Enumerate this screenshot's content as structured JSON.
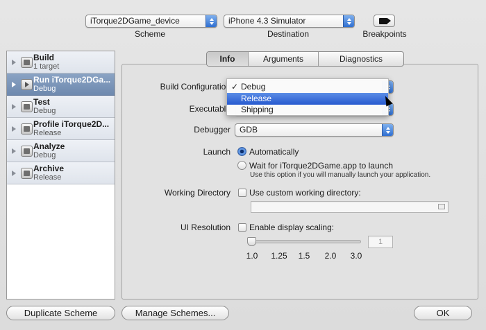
{
  "header": {
    "scheme_value": "iTorque2DGame_device",
    "scheme_caption": "Scheme",
    "destination_value": "iPhone 4.3 Simulator",
    "destination_caption": "Destination",
    "breakpoints_caption": "Breakpoints"
  },
  "actions": [
    {
      "name": "Build",
      "sub": "1 target"
    },
    {
      "name": "Run iTorque2DGa...",
      "sub": "Debug"
    },
    {
      "name": "Test",
      "sub": "Debug"
    },
    {
      "name": "Profile iTorque2D...",
      "sub": "Release"
    },
    {
      "name": "Analyze",
      "sub": "Debug"
    },
    {
      "name": "Archive",
      "sub": "Release"
    }
  ],
  "tabs": [
    "Info",
    "Arguments",
    "Diagnostics"
  ],
  "form": {
    "build_config_label": "Build Configuration",
    "executable_label": "Executable",
    "debugger_label": "Debugger",
    "debugger_value": "GDB",
    "launch_label": "Launch",
    "launch_auto": "Automatically",
    "launch_wait": "Wait for iTorque2DGame.app to launch",
    "launch_hint": "Use this option if you will manually launch your application.",
    "working_dir_label": "Working Directory",
    "working_dir_option": "Use custom working directory:",
    "ui_res_label": "UI Resolution",
    "ui_res_option": "Enable display scaling:",
    "scale_value": "1",
    "scale_ticks": [
      "1.0",
      "1.25",
      "1.5",
      "2.0",
      "3.0"
    ]
  },
  "menu": {
    "items": [
      "Debug",
      "Release",
      "Shipping"
    ],
    "checked": "Debug",
    "highlighted": "Release",
    "checkmark": "✓"
  },
  "buttons": {
    "duplicate": "Duplicate Scheme",
    "manage": "Manage Schemes...",
    "ok": "OK"
  },
  "colors": {
    "selection": "#2659cf",
    "selected_row": "#7a93b6"
  }
}
